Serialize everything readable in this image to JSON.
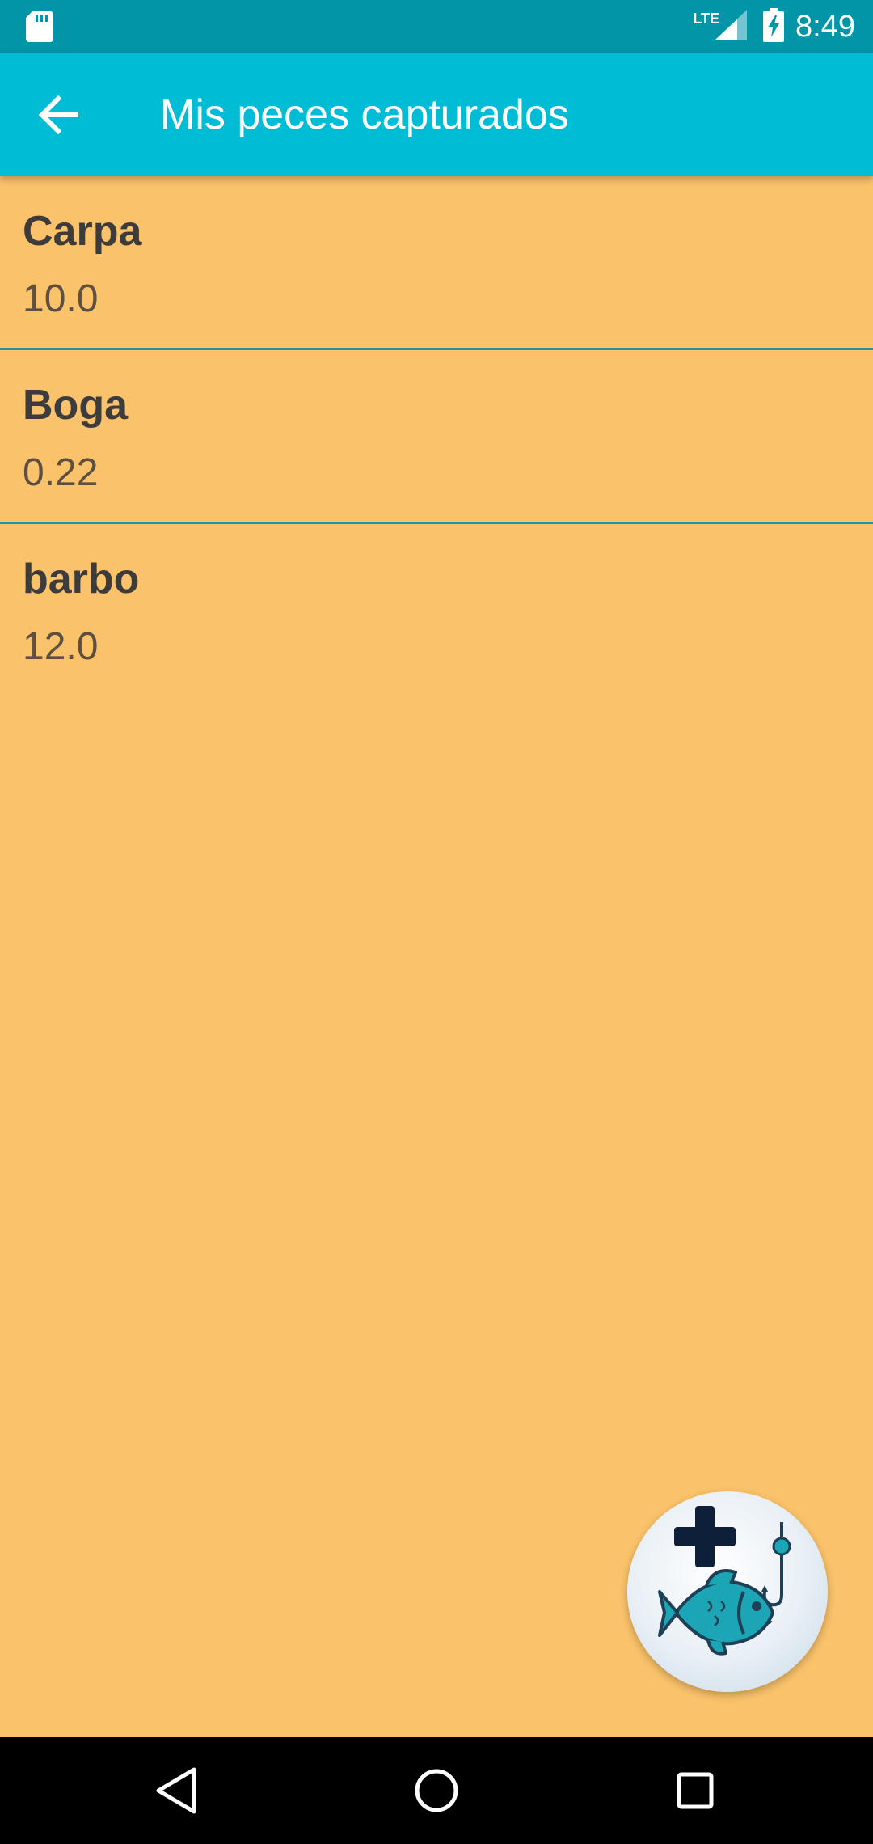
{
  "status_bar": {
    "network": "LTE",
    "time": "8:49",
    "icons": [
      "sd-card-icon",
      "signal-icon",
      "battery-charging-icon"
    ]
  },
  "app_bar": {
    "title": "Mis peces capturados",
    "back_icon": "arrow-back-icon"
  },
  "fish_list": [
    {
      "name": "Carpa",
      "value": "10.0"
    },
    {
      "name": "Boga",
      "value": "0.22"
    },
    {
      "name": "barbo",
      "value": "12.0"
    }
  ],
  "fab": {
    "icon": "add-fish-icon"
  },
  "nav_bar": {
    "icons": [
      "back-triangle-icon",
      "home-circle-icon",
      "recents-square-icon"
    ]
  },
  "colors": {
    "status_bar": "#0295A8",
    "app_bar": "#00BCD4",
    "background": "#FAC26A",
    "divider": "#1E95A1",
    "fish": "#1BA5B5"
  }
}
